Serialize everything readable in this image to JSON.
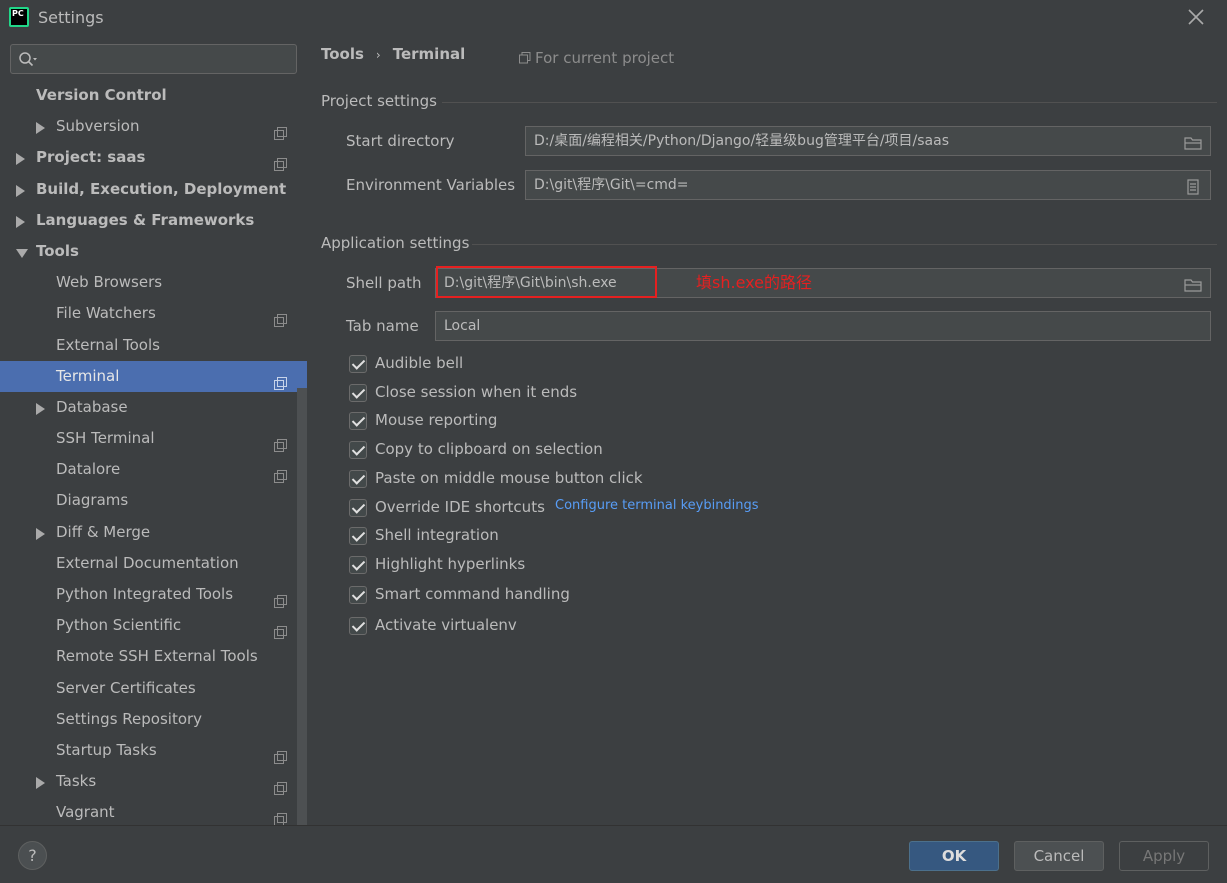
{
  "window": {
    "title": "Settings",
    "app_icon_text": "PC"
  },
  "search": {
    "placeholder": "",
    "value": ""
  },
  "sidebar": {
    "items": [
      {
        "label": "Version Control",
        "bold": true,
        "indent": 0,
        "arrow": "none",
        "copy": false
      },
      {
        "label": "Subversion",
        "bold": false,
        "indent": 1,
        "arrow": "right",
        "copy": true
      },
      {
        "label": "Project: saas",
        "bold": true,
        "indent": 0,
        "arrow": "right",
        "copy": true
      },
      {
        "label": "Build, Execution, Deployment",
        "bold": true,
        "indent": 0,
        "arrow": "right",
        "copy": false
      },
      {
        "label": "Languages & Frameworks",
        "bold": true,
        "indent": 0,
        "arrow": "right",
        "copy": false
      },
      {
        "label": "Tools",
        "bold": true,
        "indent": 0,
        "arrow": "down",
        "copy": false
      },
      {
        "label": "Web Browsers",
        "bold": false,
        "indent": 1,
        "arrow": "none",
        "copy": false
      },
      {
        "label": "File Watchers",
        "bold": false,
        "indent": 1,
        "arrow": "none",
        "copy": true
      },
      {
        "label": "External Tools",
        "bold": false,
        "indent": 1,
        "arrow": "none",
        "copy": false
      },
      {
        "label": "Terminal",
        "bold": false,
        "indent": 1,
        "arrow": "none",
        "copy": true,
        "selected": true
      },
      {
        "label": "Database",
        "bold": false,
        "indent": 1,
        "arrow": "right",
        "copy": false
      },
      {
        "label": "SSH Terminal",
        "bold": false,
        "indent": 1,
        "arrow": "none",
        "copy": true
      },
      {
        "label": "Datalore",
        "bold": false,
        "indent": 1,
        "arrow": "none",
        "copy": true
      },
      {
        "label": "Diagrams",
        "bold": false,
        "indent": 1,
        "arrow": "none",
        "copy": false
      },
      {
        "label": "Diff & Merge",
        "bold": false,
        "indent": 1,
        "arrow": "right",
        "copy": false
      },
      {
        "label": "External Documentation",
        "bold": false,
        "indent": 1,
        "arrow": "none",
        "copy": false
      },
      {
        "label": "Python Integrated Tools",
        "bold": false,
        "indent": 1,
        "arrow": "none",
        "copy": true
      },
      {
        "label": "Python Scientific",
        "bold": false,
        "indent": 1,
        "arrow": "none",
        "copy": true
      },
      {
        "label": "Remote SSH External Tools",
        "bold": false,
        "indent": 1,
        "arrow": "none",
        "copy": false
      },
      {
        "label": "Server Certificates",
        "bold": false,
        "indent": 1,
        "arrow": "none",
        "copy": false
      },
      {
        "label": "Settings Repository",
        "bold": false,
        "indent": 1,
        "arrow": "none",
        "copy": false
      },
      {
        "label": "Startup Tasks",
        "bold": false,
        "indent": 1,
        "arrow": "none",
        "copy": true
      },
      {
        "label": "Tasks",
        "bold": false,
        "indent": 1,
        "arrow": "right",
        "copy": true
      },
      {
        "label": "Vagrant",
        "bold": false,
        "indent": 1,
        "arrow": "none",
        "copy": true
      }
    ]
  },
  "breadcrumb": {
    "parent": "Tools",
    "separator": "›",
    "current": "Terminal"
  },
  "scope": {
    "label": "For current project",
    "icon": "copy-icon"
  },
  "project_settings": {
    "heading": "Project settings",
    "start_directory_label": "Start directory",
    "start_directory_value": "D:/桌面/编程相关/Python/Django/轻量级bug管理平台/项目/saas",
    "env_vars_label": "Environment Variables",
    "env_vars_value": "D:\\git\\程序\\Git\\=cmd="
  },
  "app_settings": {
    "heading": "Application settings",
    "shell_path_label": "Shell path",
    "shell_path_value": "D:\\git\\程序\\Git\\bin\\sh.exe",
    "annotation": "填sh.exe的路径",
    "tab_name_label": "Tab name",
    "tab_name_value": "Local",
    "checkboxes": [
      {
        "label": "Audible bell",
        "checked": true
      },
      {
        "label": "Close session when it ends",
        "checked": true
      },
      {
        "label": "Mouse reporting",
        "checked": true
      },
      {
        "label": "Copy to clipboard on selection",
        "checked": true
      },
      {
        "label": "Paste on middle mouse button click",
        "checked": true
      },
      {
        "label": "Override IDE shortcuts",
        "checked": true
      },
      {
        "label": "Shell integration",
        "checked": true
      },
      {
        "label": "Highlight hyperlinks",
        "checked": true
      },
      {
        "label": "Smart command handling",
        "checked": true
      },
      {
        "label": "Activate virtualenv",
        "checked": true
      }
    ],
    "keybindings_link": "Configure terminal keybindings"
  },
  "footer": {
    "help": "?",
    "ok": "OK",
    "cancel": "Cancel",
    "apply": "Apply"
  },
  "colors": {
    "background": "#3c3f41",
    "selection": "#4b6eaf",
    "link": "#589df6",
    "annotation": "#e52020",
    "ok_button": "#365880"
  }
}
